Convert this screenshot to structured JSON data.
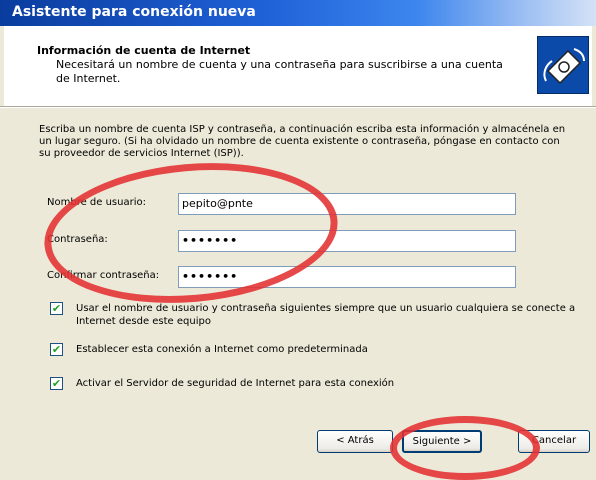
{
  "window": {
    "title": "Asistente para conexión nueva"
  },
  "header": {
    "title": "Información de cuenta de Internet",
    "description": "Necesitará un nombre de cuenta y una contraseña para suscribirse a una cuenta de Internet."
  },
  "intro": "Escriba un nombre de cuenta ISP y contraseña, a continuación escriba esta información y almacénela en un lugar seguro. (Si ha olvidado un nombre de cuenta existente o contraseña, póngase en contacto con su proveedor de servicios Internet (ISP)).",
  "form": {
    "username_label": "Nombre de usuario:",
    "username_value": "pepito@pnte",
    "password_label": "Contraseña:",
    "password_value": "•••••••",
    "confirm_label": "Confirmar contraseña:",
    "confirm_value": "•••••••"
  },
  "options": [
    {
      "label": "Usar el nombre de usuario y contraseña siguientes siempre que un usuario cualquiera se conecte a Internet desde este equipo",
      "checked": true
    },
    {
      "label": "Establecer esta conexión a Internet como predeterminada",
      "checked": true
    },
    {
      "label": "Activar el Servidor de seguridad de Internet para esta conexión",
      "checked": true
    }
  ],
  "buttons": {
    "back": "< Atrás",
    "next": "Siguiente >",
    "cancel": "Cancelar"
  },
  "icons": {
    "header": "network-phone-icon",
    "check": "check-icon"
  },
  "colors": {
    "title_bar": "#1f62d8",
    "annotation": "#e23030",
    "check": "#21a121"
  }
}
